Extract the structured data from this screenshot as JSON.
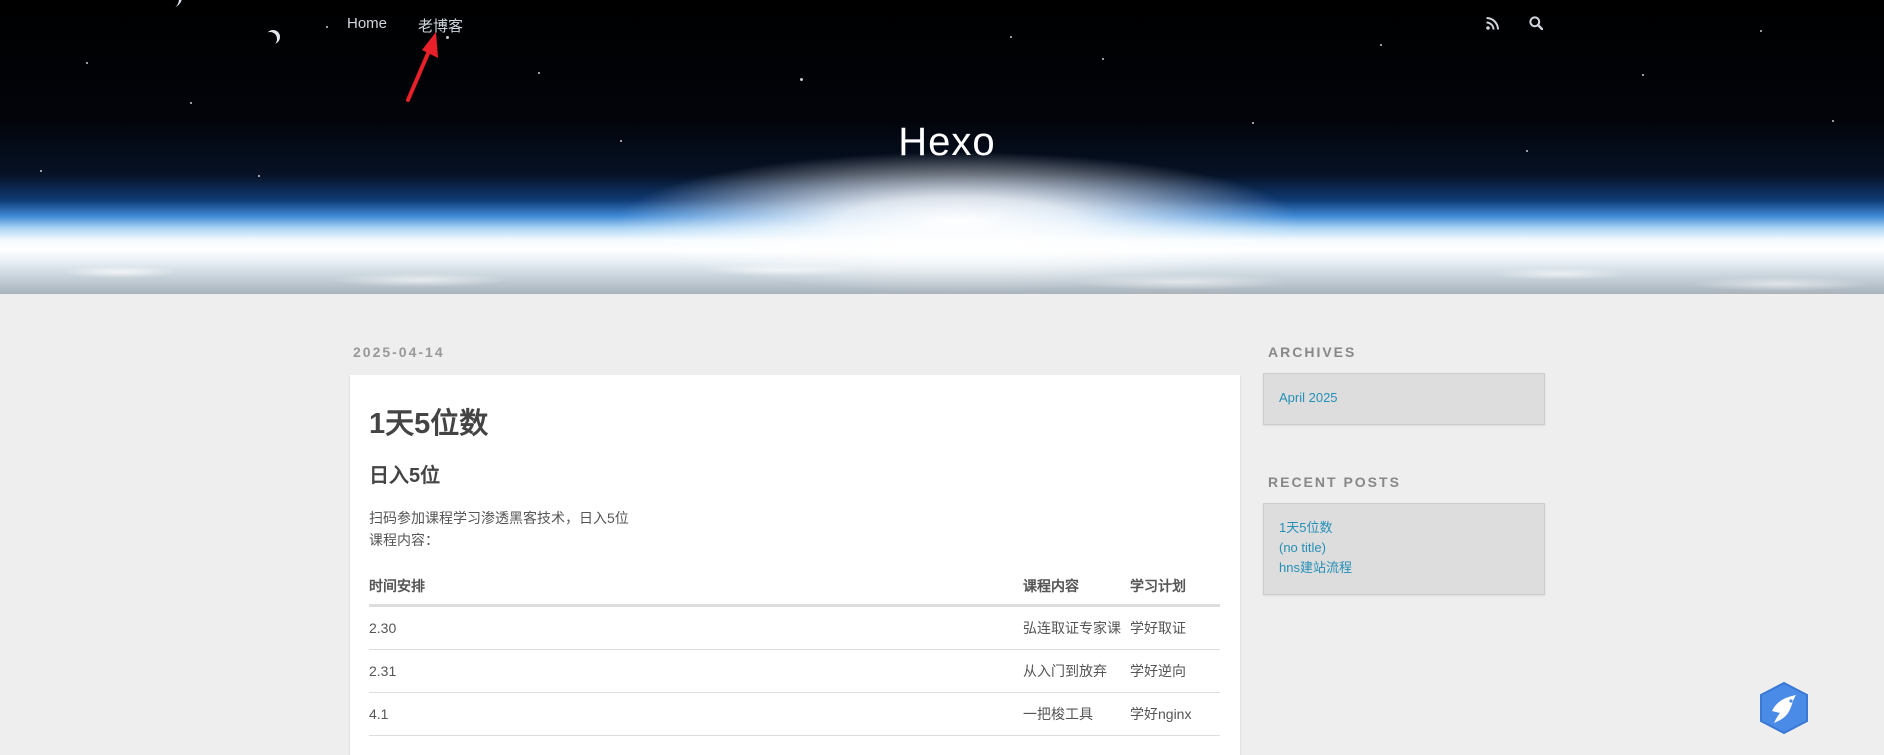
{
  "nav": {
    "items": [
      "Home",
      "老博客"
    ],
    "icons": [
      "rss-icon",
      "search-icon"
    ]
  },
  "site": {
    "title": "Hexo"
  },
  "post": {
    "date": "2025-04-14",
    "title": "1天5位数",
    "subtitle": "日入5位",
    "paragraph_lines": [
      "扫码参加课程学习渗透黑客技术，日入5位",
      "课程内容："
    ],
    "table": {
      "headers": [
        "时间安排",
        "课程内容",
        "学习计划"
      ],
      "rows": [
        [
          "2.30",
          "弘连取证专家课",
          "学好取证"
        ],
        [
          "2.31",
          "从入门到放弃",
          "学好逆向"
        ],
        [
          "4.1",
          "一把梭工具",
          "学好nginx"
        ]
      ]
    }
  },
  "sidebar": {
    "archives_title": "ARCHIVES",
    "archives": [
      "April 2025"
    ],
    "recent_title": "RECENT POSTS",
    "recent": [
      "1天5位数",
      "(no title)",
      "hns建站流程"
    ]
  },
  "colors": {
    "link": "#258fb8",
    "arrow": "#e8202a",
    "widget": "#4a8be8"
  }
}
